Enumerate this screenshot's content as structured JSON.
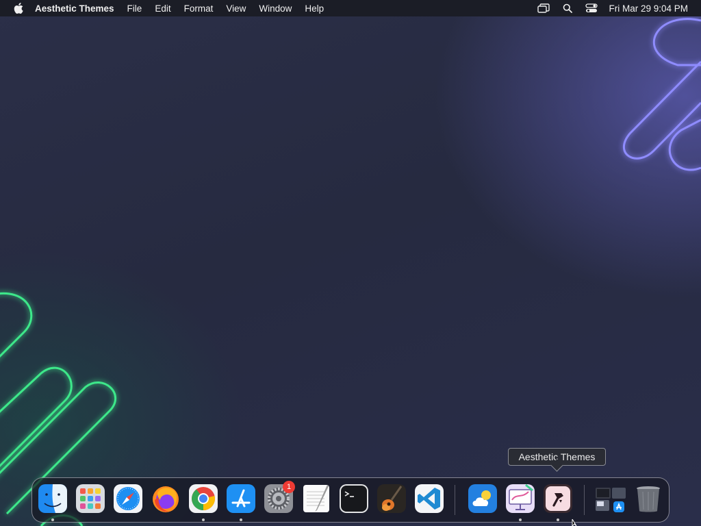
{
  "menubar": {
    "app_name": "Aesthetic Themes",
    "menus": [
      "File",
      "Edit",
      "Format",
      "View",
      "Window",
      "Help"
    ],
    "clock": "Fri Mar 29  9:04 PM",
    "status_icons": [
      "screen-mirroring-icon",
      "spotlight-search-icon",
      "control-center-icon"
    ]
  },
  "tooltip": {
    "text": "Aesthetic Themes"
  },
  "dock": {
    "items": [
      {
        "name": "finder",
        "icon": "finder-icon",
        "running": true
      },
      {
        "name": "launchpad",
        "icon": "launchpad-icon",
        "running": false
      },
      {
        "name": "safari",
        "icon": "safari-icon",
        "running": false
      },
      {
        "name": "firefox",
        "icon": "firefox-icon",
        "running": false
      },
      {
        "name": "chrome",
        "icon": "chrome-icon",
        "running": true
      },
      {
        "name": "app-store",
        "icon": "app-store-icon",
        "running": true
      },
      {
        "name": "system-settings",
        "icon": "system-settings-icon",
        "running": false,
        "badge": "1"
      },
      {
        "name": "textedit",
        "icon": "textedit-icon",
        "running": false
      },
      {
        "name": "terminal",
        "icon": "terminal-icon",
        "running": false
      },
      {
        "name": "garageband",
        "icon": "garageband-icon",
        "running": false
      },
      {
        "name": "vscode",
        "icon": "vscode-icon",
        "running": false
      },
      {
        "name": "weather",
        "icon": "weather-icon",
        "running": false
      },
      {
        "name": "presentation-app",
        "icon": "presentation-icon",
        "running": true
      },
      {
        "name": "aesthetic-themes",
        "icon": "aesthetic-themes-icon",
        "running": true
      },
      {
        "name": "recent-apps-folder",
        "icon": "app-folder-icon",
        "running": false
      },
      {
        "name": "trash",
        "icon": "trash-icon",
        "running": false
      }
    ]
  },
  "colors": {
    "menubar_bg": "#1b1d26",
    "neon_green": "#3ee88a",
    "neon_purple": "#8f8cff",
    "badge_red": "#ee3b34"
  }
}
